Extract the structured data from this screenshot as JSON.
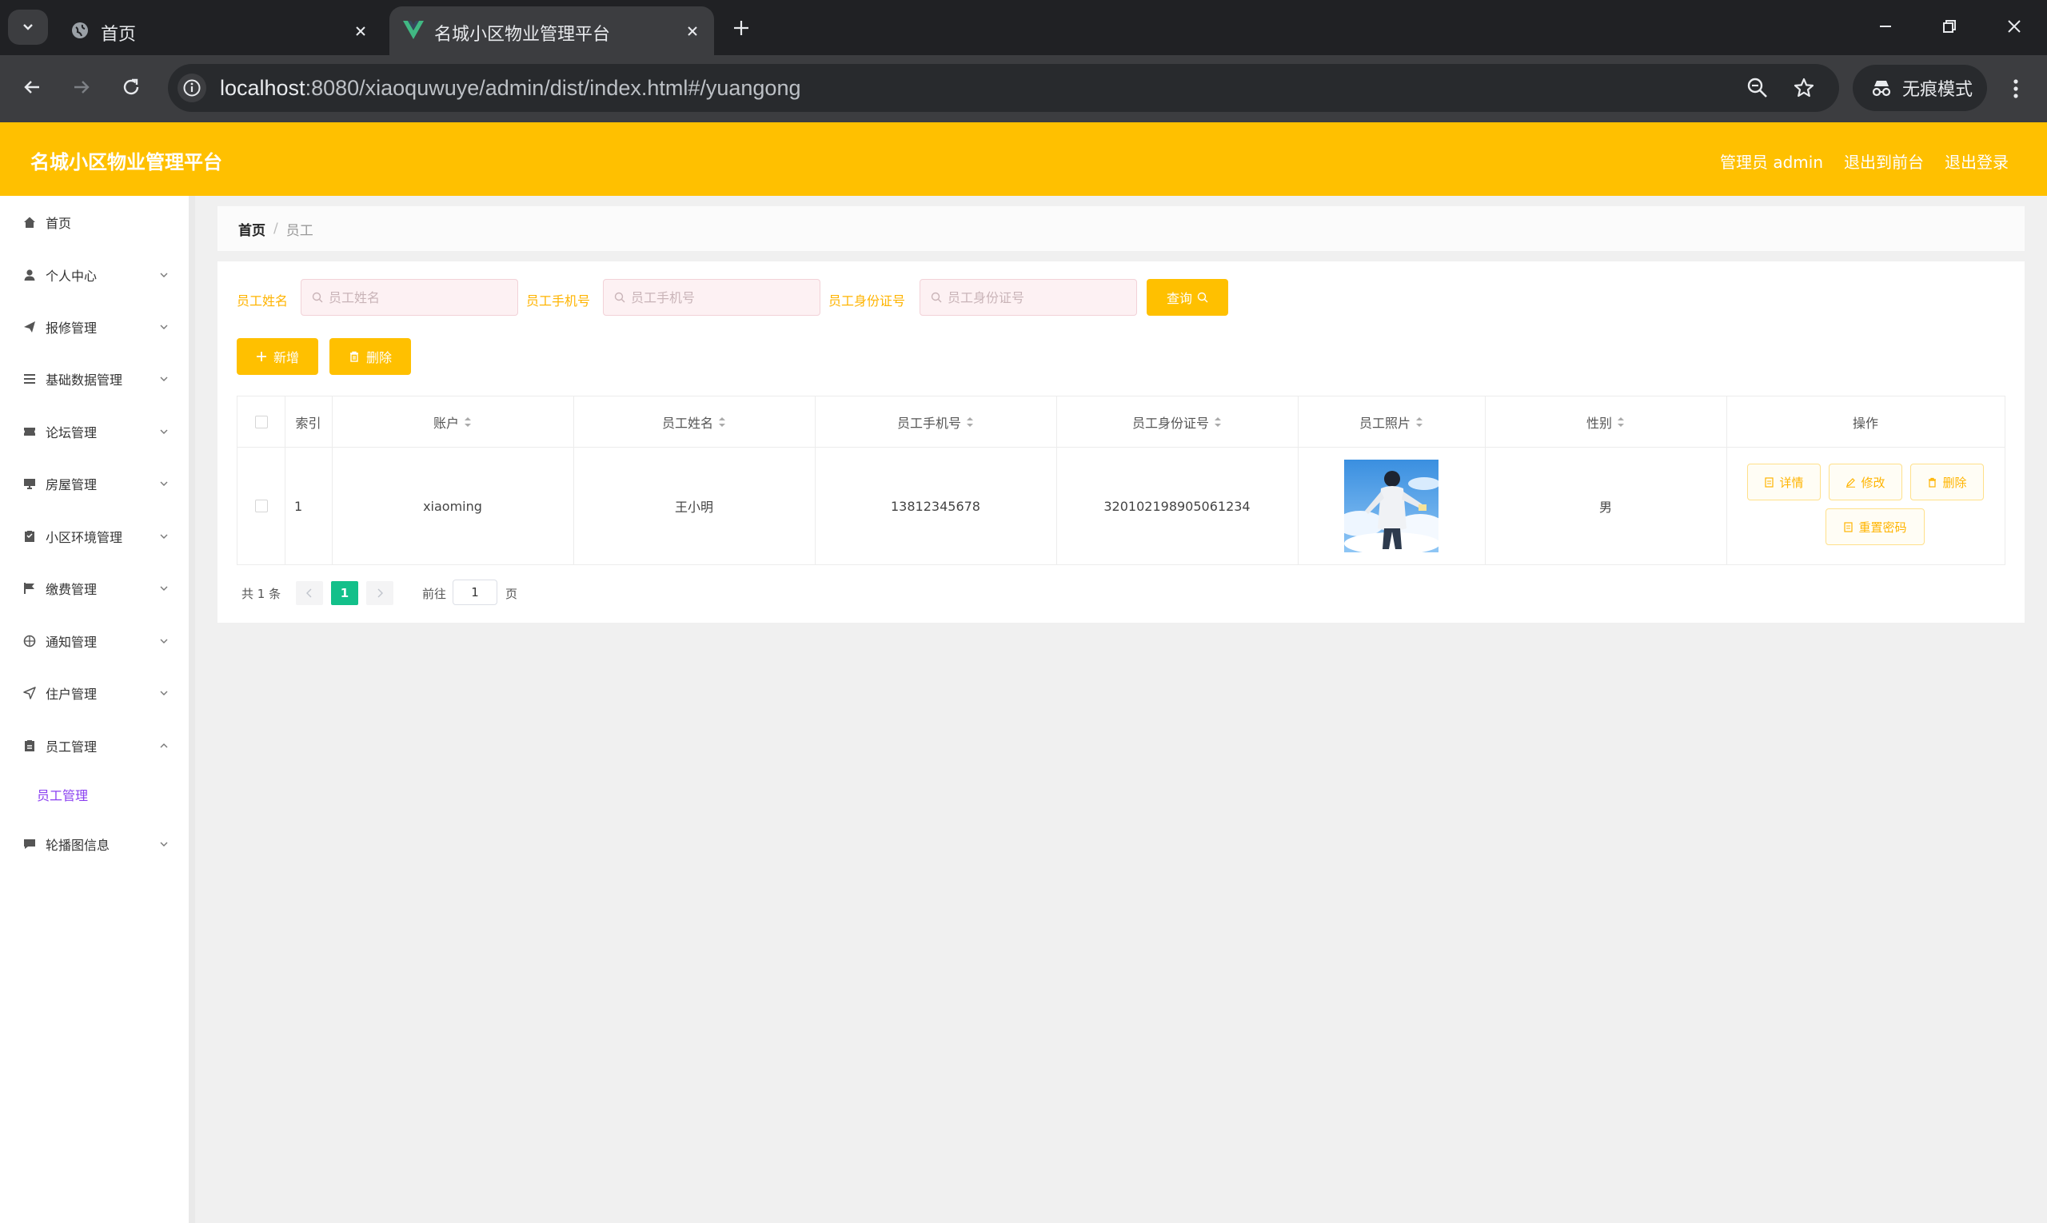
{
  "browser": {
    "tabs": [
      {
        "title": "首页",
        "active": false
      },
      {
        "title": "名城小区物业管理平台",
        "active": true
      }
    ],
    "url_host": "localhost",
    "url_rest": ":8080/xiaoquwuye/admin/dist/index.html#/yuangong",
    "incognito_label": "无痕模式"
  },
  "header": {
    "title": "名城小区物业管理平台",
    "admin_label": "管理员 admin",
    "front_label": "退出到前台",
    "logout_label": "退出登录",
    "accent_color": "#ffc000"
  },
  "sidebar": {
    "items": [
      {
        "label": "首页",
        "icon": "home-icon"
      },
      {
        "label": "个人中心",
        "icon": "user-icon"
      },
      {
        "label": "报修管理",
        "icon": "send-icon"
      },
      {
        "label": "基础数据管理",
        "icon": "list-icon"
      },
      {
        "label": "论坛管理",
        "icon": "ticket-icon"
      },
      {
        "label": "房屋管理",
        "icon": "monitor-icon"
      },
      {
        "label": "小区环境管理",
        "icon": "clipboard-icon"
      },
      {
        "label": "缴费管理",
        "icon": "flag-icon"
      },
      {
        "label": "通知管理",
        "icon": "globe-icon"
      },
      {
        "label": "住户管理",
        "icon": "paper-plane-icon"
      },
      {
        "label": "员工管理",
        "icon": "document-icon"
      },
      {
        "label": "轮播图信息",
        "icon": "comment-icon"
      }
    ],
    "submenu_active": "员工管理"
  },
  "breadcrumb": {
    "home": "首页",
    "sep": "/",
    "current": "员工"
  },
  "filters": {
    "name_label": "员工姓名",
    "name_placeholder": "员工姓名",
    "phone_label": "员工手机号",
    "phone_placeholder": "员工手机号",
    "idcard_label": "员工身份证号",
    "idcard_placeholder": "员工身份证号",
    "query_label": "查询"
  },
  "actions": {
    "add_label": "新增",
    "delete_label": "删除"
  },
  "table": {
    "headers": {
      "index": "索引",
      "account": "账户",
      "name": "员工姓名",
      "phone": "员工手机号",
      "idcard": "员工身份证号",
      "photo": "员工照片",
      "gender": "性别",
      "ops": "操作"
    },
    "rows": [
      {
        "index": "1",
        "account": "xiaoming",
        "name": "王小明",
        "phone": "13812345678",
        "idcard": "320102198905061234",
        "gender": "男"
      }
    ],
    "op_labels": {
      "detail": "详情",
      "edit": "修改",
      "delete": "删除",
      "reset": "重置密码"
    }
  },
  "pagination": {
    "total": "共 1 条",
    "current_page": "1",
    "goto_label": "前往",
    "goto_value": "1",
    "page_unit": "页"
  }
}
